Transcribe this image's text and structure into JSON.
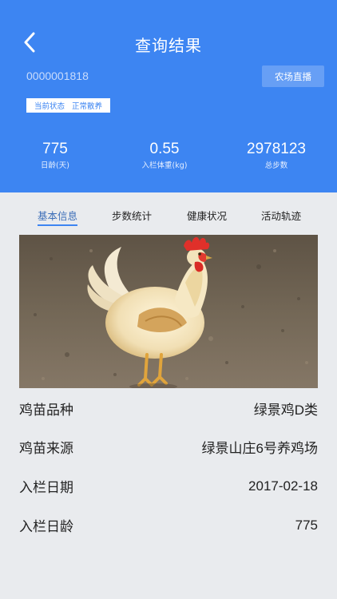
{
  "header": {
    "title": "查询结果",
    "record_id": "0000001818",
    "live_button": "农场直播",
    "status": {
      "label": "当前状态",
      "value": "正常散养"
    },
    "stats": [
      {
        "value": "775",
        "label": "日龄(天)"
      },
      {
        "value": "0.55",
        "label": "入栏体重(kg)"
      },
      {
        "value": "2978123",
        "label": "总步数"
      }
    ]
  },
  "tabs": [
    {
      "label": "基本信息",
      "active": true
    },
    {
      "label": "步数统计",
      "active": false
    },
    {
      "label": "健康状况",
      "active": false
    },
    {
      "label": "活动轨迹",
      "active": false
    }
  ],
  "info": [
    {
      "label": "鸡苗品种",
      "value": "绿景鸡D类"
    },
    {
      "label": "鸡苗来源",
      "value": "绿景山庄6号养鸡场"
    },
    {
      "label": "入栏日期",
      "value": "2017-02-18"
    },
    {
      "label": "入栏日龄",
      "value": "775"
    }
  ],
  "colors": {
    "header_bg": "#3d85f2",
    "page_bg": "#e9ebee",
    "accent": "#3d85f2"
  },
  "icons": {
    "back": "chevron-left-icon"
  }
}
